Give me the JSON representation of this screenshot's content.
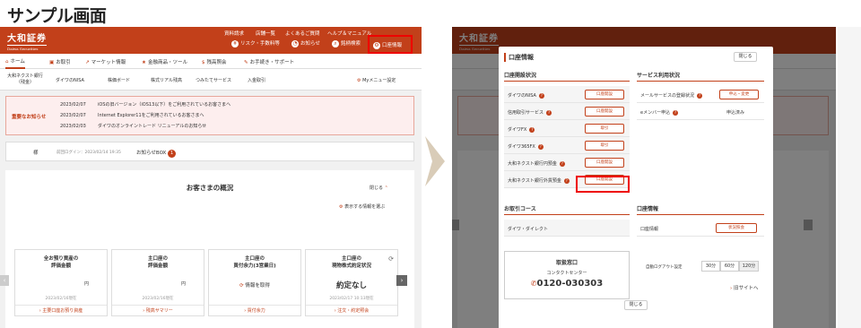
{
  "heading": "サンプル画面",
  "left": {
    "logo": "大和証券",
    "logo_sub": "Daiwa Securities",
    "top_links": [
      "資料請求",
      "店舗一覧",
      "よくあるご質問",
      "ヘルプ＆マニュアル"
    ],
    "red_buttons": [
      "リスク・手数料等",
      "お知らせ",
      "銘柄検索",
      "口座情報"
    ],
    "nav": [
      "ホーム",
      "お取引",
      "マーケット情報",
      "金融商品・ツール",
      "残高照会",
      "お手続き・サポート"
    ],
    "sub": [
      "大和ネクスト銀行（残金）",
      "ダイワのNISA",
      "株価ボード",
      "株式リアル残高",
      "つみたてサービス",
      "入金取引",
      "Myメニュー設定"
    ],
    "notice_label": "重要なお知らせ",
    "notices": [
      {
        "date": "2023/02/07",
        "text": "iOSの旧バージョン（iOS13以下）をご利用されているお客さまへ"
      },
      {
        "date": "2023/02/07",
        "text": "Internet Explorer11をご利用されているお客さまへ"
      },
      {
        "date": "2023/02/03",
        "text": "ダイワのオンライントレード リニューアルのお知らせ"
      }
    ],
    "info_name": "様",
    "info_login": "前回ログイン：2023/02/14 19:35",
    "info_box": "お知らせBOX",
    "info_badge": "1",
    "overview_title": "お客さまの概況",
    "overview_close": "閉じる",
    "overview_select": "表示する情報を選ぶ",
    "cards": [
      {
        "title": "全お預り資産の\n評価金額",
        "value": "円",
        "date": "2023/02/16現在",
        "link": "主要口座お預り資産"
      },
      {
        "title": "主口座の\n評価金額",
        "value": "円",
        "date": "2023/02/16現在",
        "link": "残高サマリー"
      },
      {
        "title": "主口座の\n買付余力(3営業日)",
        "value": "情報を取得",
        "date": "",
        "link": "買付余力"
      },
      {
        "title": "主口座の\n現物株式約定状況",
        "value": "約定なし",
        "date": "2023/02/17 10:13現在",
        "link": "注文・約定照会"
      }
    ]
  },
  "modal": {
    "title": "口座情報",
    "close_top": "閉じる",
    "sec1": "口座開設状況",
    "rows1": [
      {
        "label": "ダイワのNISA",
        "btn": "口座開設"
      },
      {
        "label": "信用取引サービス",
        "btn": "口座開設"
      },
      {
        "label": "ダイワFX",
        "btn": "取引"
      },
      {
        "label": "ダイワ365FX",
        "btn": "取引"
      },
      {
        "label": "大和ネクスト銀行円預金",
        "btn": "口座開設"
      },
      {
        "label": "大和ネクスト銀行外貨預金",
        "btn": "口座開設"
      }
    ],
    "sec2": "サービス利用状況",
    "rows2": [
      {
        "label": "メールサービスの登録状況",
        "btn": "申込・変更"
      },
      {
        "label": "eメンバー申込",
        "value": "申込済み"
      }
    ],
    "sec3": "お取引コース",
    "course": "ダイワ・ダイレクト",
    "sec4": "口座情報",
    "acct_label": "口座情報",
    "acct_btn": "状況照会",
    "contact_title": "取扱窓口",
    "contact_sub": "コンタクトセンター",
    "phone": "0120-030303",
    "logout_label": "自動ログアウト設定",
    "logout_opts": [
      "30分",
      "60分",
      "120分"
    ],
    "old_site": "旧サイトへ",
    "close_bottom": "閉じる"
  },
  "colors": {
    "brand": "#c2401a",
    "highlight": "#e00000"
  }
}
